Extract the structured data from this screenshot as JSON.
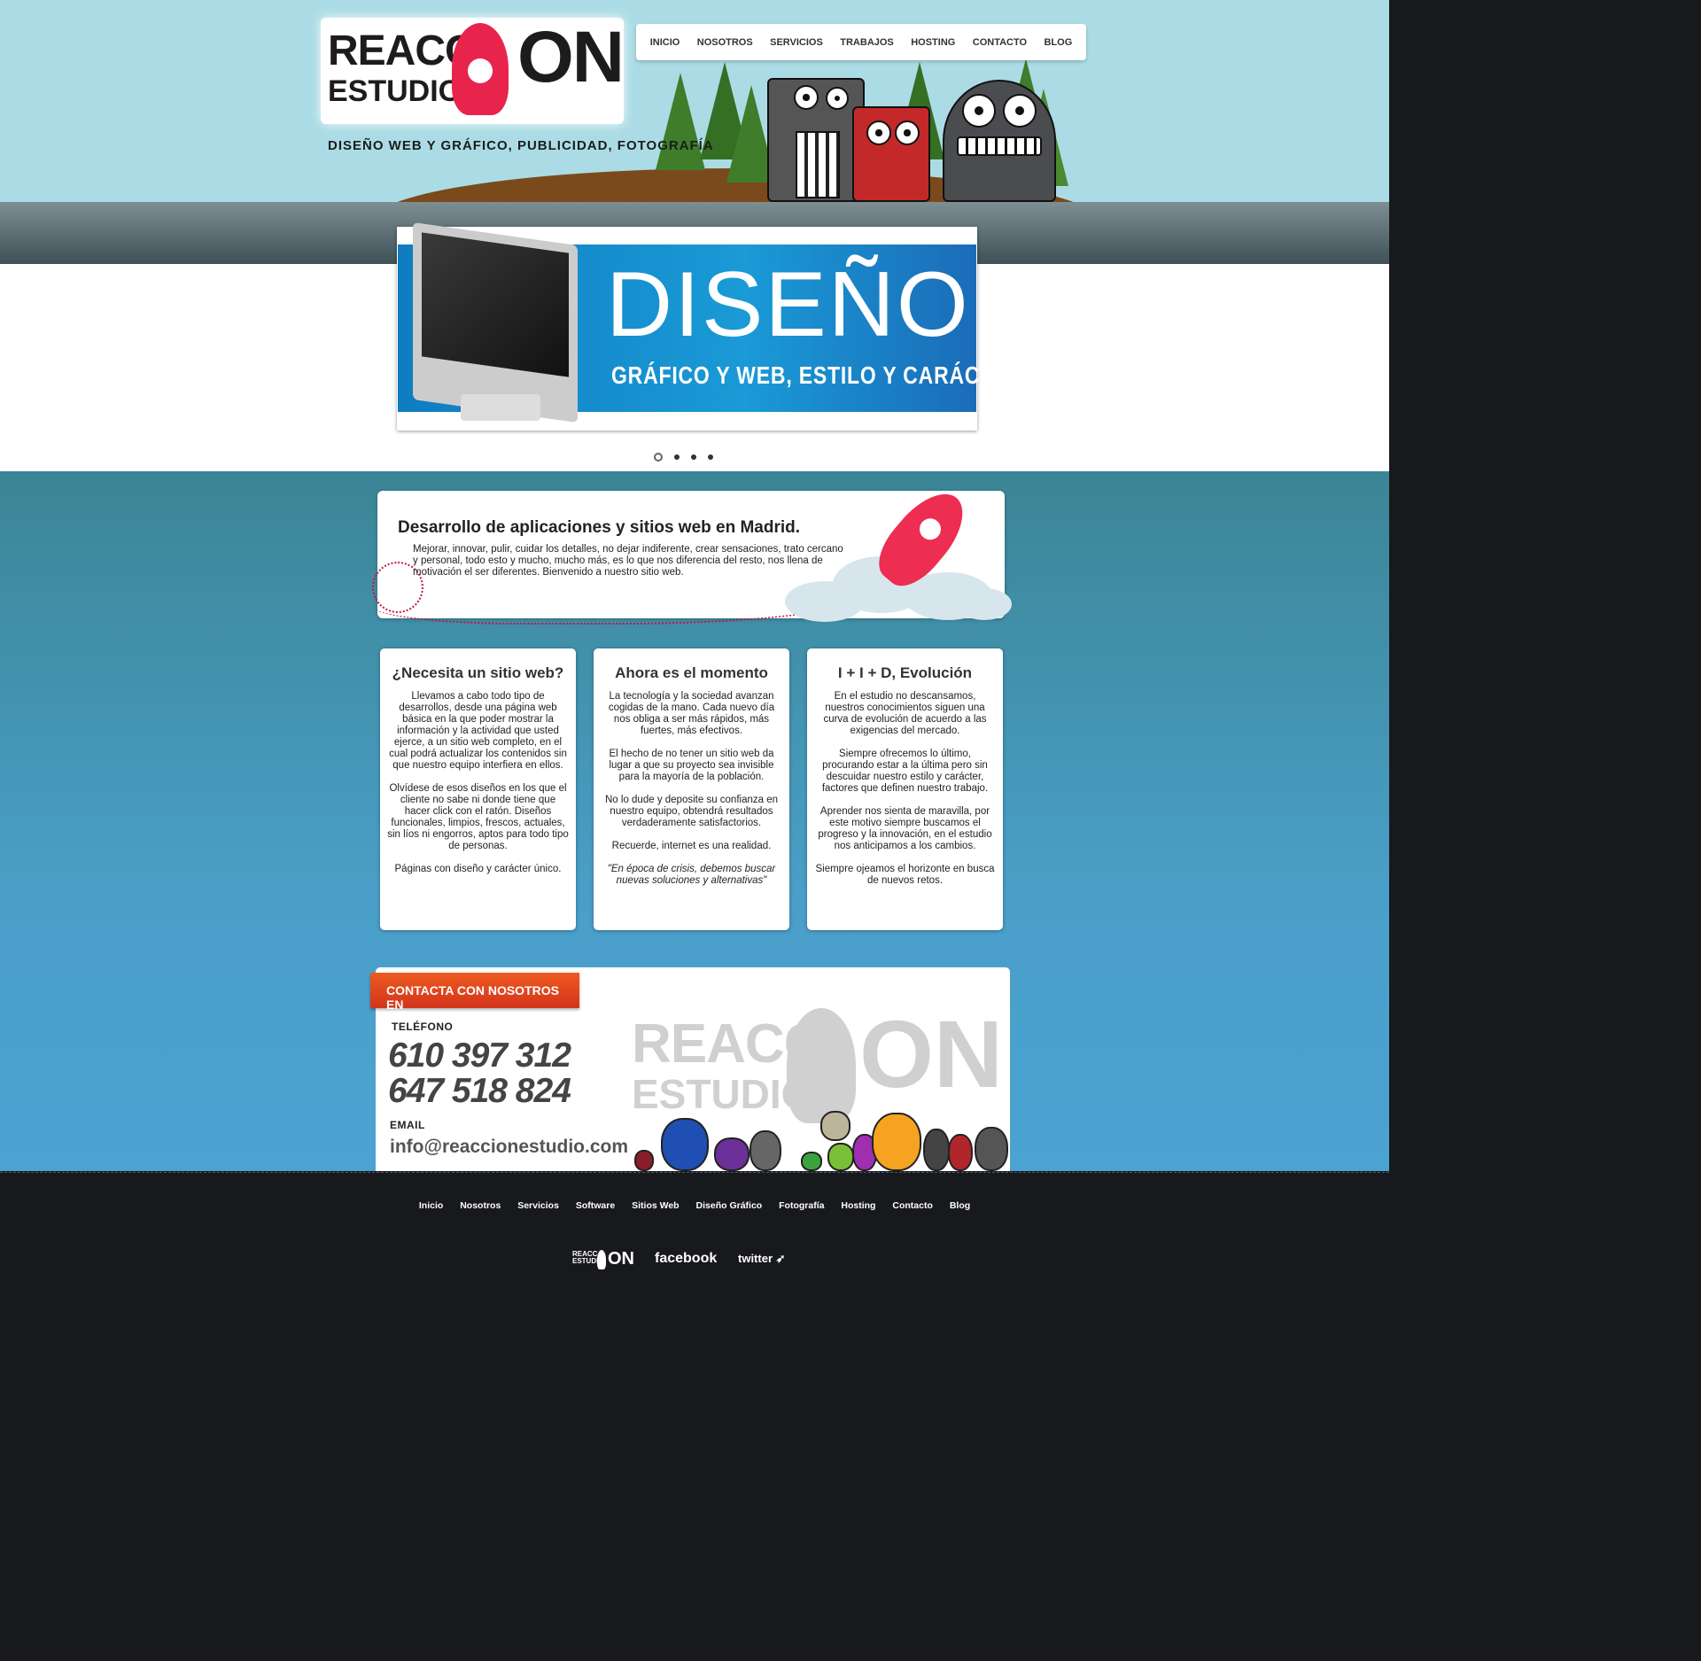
{
  "brand": {
    "logo_reacc": "REACC",
    "logo_estudio": "ESTUDIO",
    "logo_on": "ON",
    "tagline": "DISEÑO WEB Y GRÁFICO, PUBLICIDAD, FOTOGRAFÍA"
  },
  "nav": {
    "items": [
      "INICIO",
      "NOSOTROS",
      "SERVICIOS",
      "TRABAJOS",
      "HOSTING",
      "CONTACTO",
      "BLOG"
    ]
  },
  "slider": {
    "title": "DISEÑO",
    "subtitle": "GRÁFICO Y WEB, ESTILO Y CARÁCTER",
    "slide_count": 4,
    "active_slide": 1
  },
  "intro": {
    "title": "Desarrollo de aplicaciones y sitios web en Madrid.",
    "text": "Mejorar, innovar, pulir, cuidar los detalles, no dejar indiferente, crear sensaciones, trato cercano y personal, todo esto y mucho, mucho más, es lo que nos diferencia del resto, nos llena de motivación el ser diferentes. Bienvenido a nuestro sitio web."
  },
  "cards": [
    {
      "title": "¿Necesita un sitio web?",
      "paragraphs": [
        "Llevamos a cabo todo tipo de desarrollos, desde una página web básica en la que poder mostrar la información y la actividad que usted ejerce, a un sitio web completo, en el cual podrá actualizar los contenidos sin que nuestro equipo interfiera en ellos.",
        "Olvídese de esos diseños en los que el cliente no sabe ni donde tiene que hacer click con el ratón. Diseños funcionales, limpios, frescos, actuales, sin líos ni engorros, aptos para todo tipo de personas.",
        "Páginas con diseño y carácter único."
      ]
    },
    {
      "title": "Ahora es el momento",
      "paragraphs": [
        "La tecnología y la sociedad avanzan cogidas de la mano. Cada nuevo día nos obliga a ser más rápidos, más fuertes, más efectivos.",
        "El hecho de no tener un sitio web da lugar a que su proyecto sea invisible para la mayoría de la población.",
        "No lo dude y deposite su confianza en nuestro equipo, obtendrá resultados verdaderamente satisfactorios.",
        "Recuerde, internet es una realidad."
      ],
      "quote": "\"En época de crisis, debemos buscar nuevas soluciones y alternativas\""
    },
    {
      "title": "I + I + D, Evolución",
      "paragraphs": [
        "En el estudio no descansamos, nuestros conocimientos siguen una curva de evolución de acuerdo a las exigencias del mercado.",
        "Siempre ofrecemos lo último, procurando estar a la última pero sin descuidar nuestro estilo y carácter, factores que definen nuestro trabajo.",
        "Aprender nos sienta de maravilla, por este motivo siempre buscamos el progreso y la innovación, en el estudio nos anticipamos a los cambios.",
        "Siempre ojeamos el horizonte en busca de nuevos retos."
      ]
    }
  ],
  "contact": {
    "ribbon": "CONTACTA CON NOSOTROS EN",
    "phone_label": "TELÉFONO",
    "phone1": "610 397 312",
    "phone2": "647 518 824",
    "email_label": "EMAIL",
    "email": "info@reaccionestudio.com"
  },
  "footer": {
    "links": [
      "Inicio",
      "Nosotros",
      "Servicios",
      "Software",
      "Sitios Web",
      "Diseño Gráfico",
      "Fotografía",
      "Hosting",
      "Contacto",
      "Blog"
    ],
    "social_facebook": "facebook",
    "social_twitter": "twitter"
  },
  "colors": {
    "sky": "#abdce5",
    "accent_red": "#e8244d",
    "ribbon_orange": "#ee5a20",
    "footer_bg": "#18191d"
  }
}
